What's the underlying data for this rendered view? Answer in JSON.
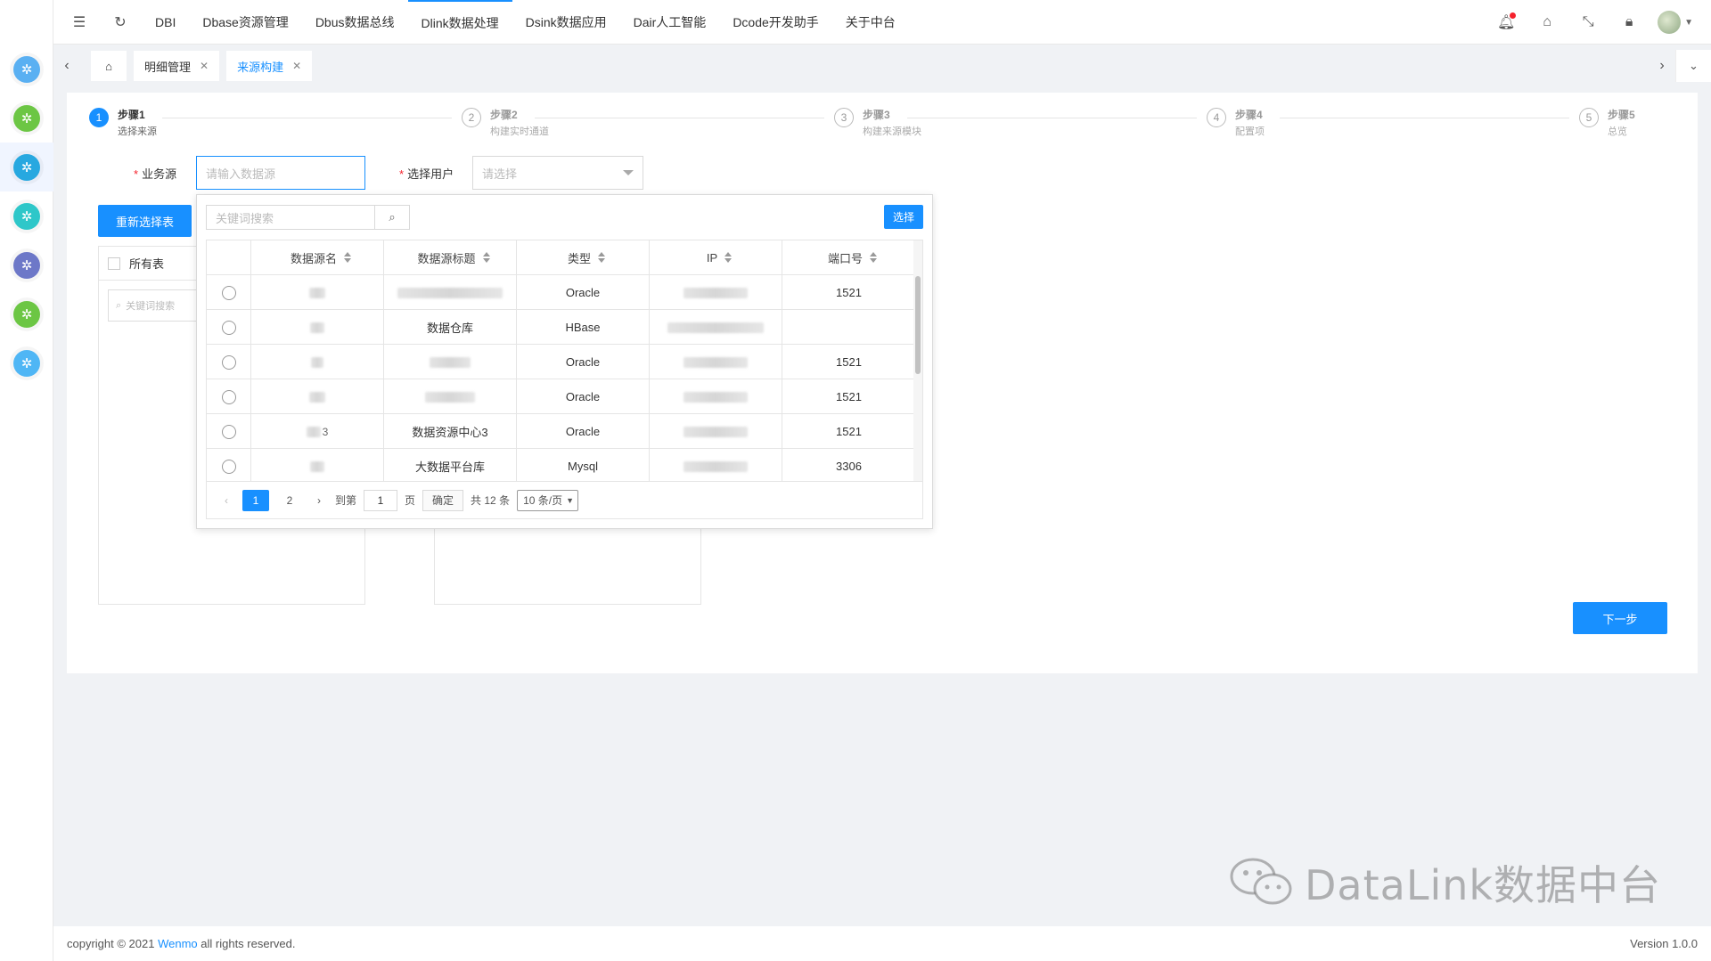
{
  "nav": {
    "items": [
      {
        "label": "DBI",
        "active": false
      },
      {
        "label": "Dbase资源管理",
        "active": false
      },
      {
        "label": "Dbus数据总线",
        "active": false
      },
      {
        "label": "Dlink数据处理",
        "active": true
      },
      {
        "label": "Dsink数据应用",
        "active": false
      },
      {
        "label": "Dair人工智能",
        "active": false
      },
      {
        "label": "Dcode开发助手",
        "active": false
      },
      {
        "label": "关于中台",
        "active": false
      }
    ]
  },
  "rail": {
    "colors": [
      "#5ab0f2",
      "#6cc644",
      "#27a8e0",
      "#2ec7c9",
      "#6d78c8",
      "#6cc644",
      "#4fb6f5"
    ]
  },
  "tabs": {
    "items": [
      {
        "label": "明细管理",
        "active": false
      },
      {
        "label": "来源构建",
        "active": true
      }
    ]
  },
  "steps": [
    {
      "num": "1",
      "title": "步骤1",
      "desc": "选择来源",
      "active": true
    },
    {
      "num": "2",
      "title": "步骤2",
      "desc": "构建实时通道",
      "active": false
    },
    {
      "num": "3",
      "title": "步骤3",
      "desc": "构建来源模块",
      "active": false
    },
    {
      "num": "4",
      "title": "步骤4",
      "desc": "配置项",
      "active": false
    },
    {
      "num": "5",
      "title": "步骤5",
      "desc": "总览",
      "active": false
    }
  ],
  "form": {
    "source_label": "业务源",
    "source_placeholder": "请输入数据源",
    "user_label": "选择用户",
    "user_placeholder": "请选择",
    "reselect_button": "重新选择表",
    "next_button": "下一步"
  },
  "left_panel": {
    "header": "所有表",
    "search_placeholder": "关键词搜索"
  },
  "popup": {
    "search_placeholder": "关键词搜索",
    "select_button": "选择",
    "columns": [
      "数据源名",
      "数据源标题",
      "类型",
      "IP",
      "端口号"
    ],
    "rows": [
      {
        "name": "",
        "title": "",
        "type": "Oracle",
        "ip": "",
        "port": "1521"
      },
      {
        "name": "",
        "title": "数据仓库",
        "type": "HBase",
        "ip": "",
        "port": ""
      },
      {
        "name": "",
        "title": "",
        "type": "Oracle",
        "ip": "",
        "port": "1521"
      },
      {
        "name": "",
        "title": "",
        "type": "Oracle",
        "ip": "",
        "port": "1521"
      },
      {
        "name": "3",
        "title": "数据资源中心3",
        "type": "Oracle",
        "ip": "",
        "port": "1521"
      },
      {
        "name": "",
        "title": "大数据平台库",
        "type": "Mysql",
        "ip": "",
        "port": "3306"
      }
    ],
    "pager": {
      "pages": [
        "1",
        "2"
      ],
      "goto_label": "到第",
      "goto_value": "1",
      "page_unit": "页",
      "confirm": "确定",
      "total": "共 12 条",
      "size": "10 条/页"
    }
  },
  "footer": {
    "copyright_prefix": "copyright © 2021 ",
    "company": "Wenmo",
    "copyright_suffix": " all rights reserved.",
    "version": "Version 1.0.0"
  },
  "watermark": {
    "text": "DataLink数据中台"
  }
}
